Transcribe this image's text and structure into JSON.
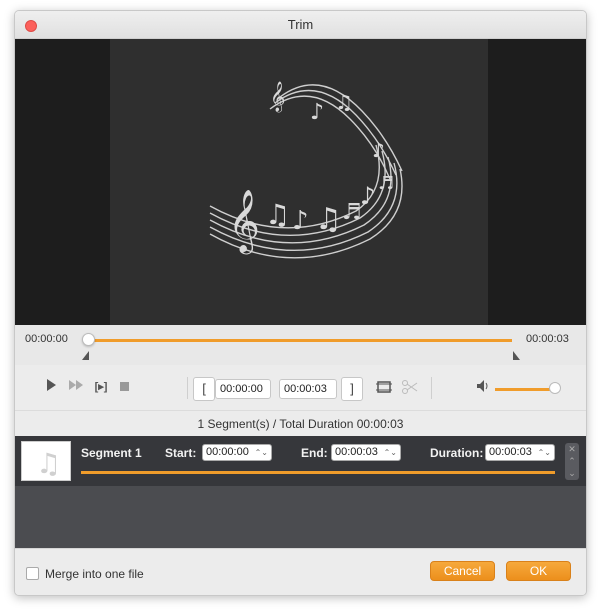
{
  "window": {
    "title": "Trim"
  },
  "timeline": {
    "start_time": "00:00:00",
    "end_time": "00:00:03"
  },
  "controls": {
    "play_icon": "play-icon",
    "forward_icon": "fast-forward-icon",
    "set_start_label": "[",
    "start_time": "00:00:00",
    "end_time": "00:00:03",
    "set_end_label": "]",
    "volume_level": 0.85
  },
  "summary": {
    "text": "1 Segment(s) / Total Duration 00:00:03"
  },
  "segments": [
    {
      "name": "Segment 1",
      "start_label": "Start:",
      "start": "00:00:00",
      "end_label": "End:",
      "end": "00:00:03",
      "duration_label": "Duration:",
      "duration": "00:00:03"
    }
  ],
  "footer": {
    "merge_label": "Merge into one file",
    "merge_checked": false,
    "cancel_label": "Cancel",
    "ok_label": "OK"
  },
  "colors": {
    "accent": "#f09c2b",
    "segment_bg": "#36373b",
    "preview_bg": "#2f2f2f"
  }
}
